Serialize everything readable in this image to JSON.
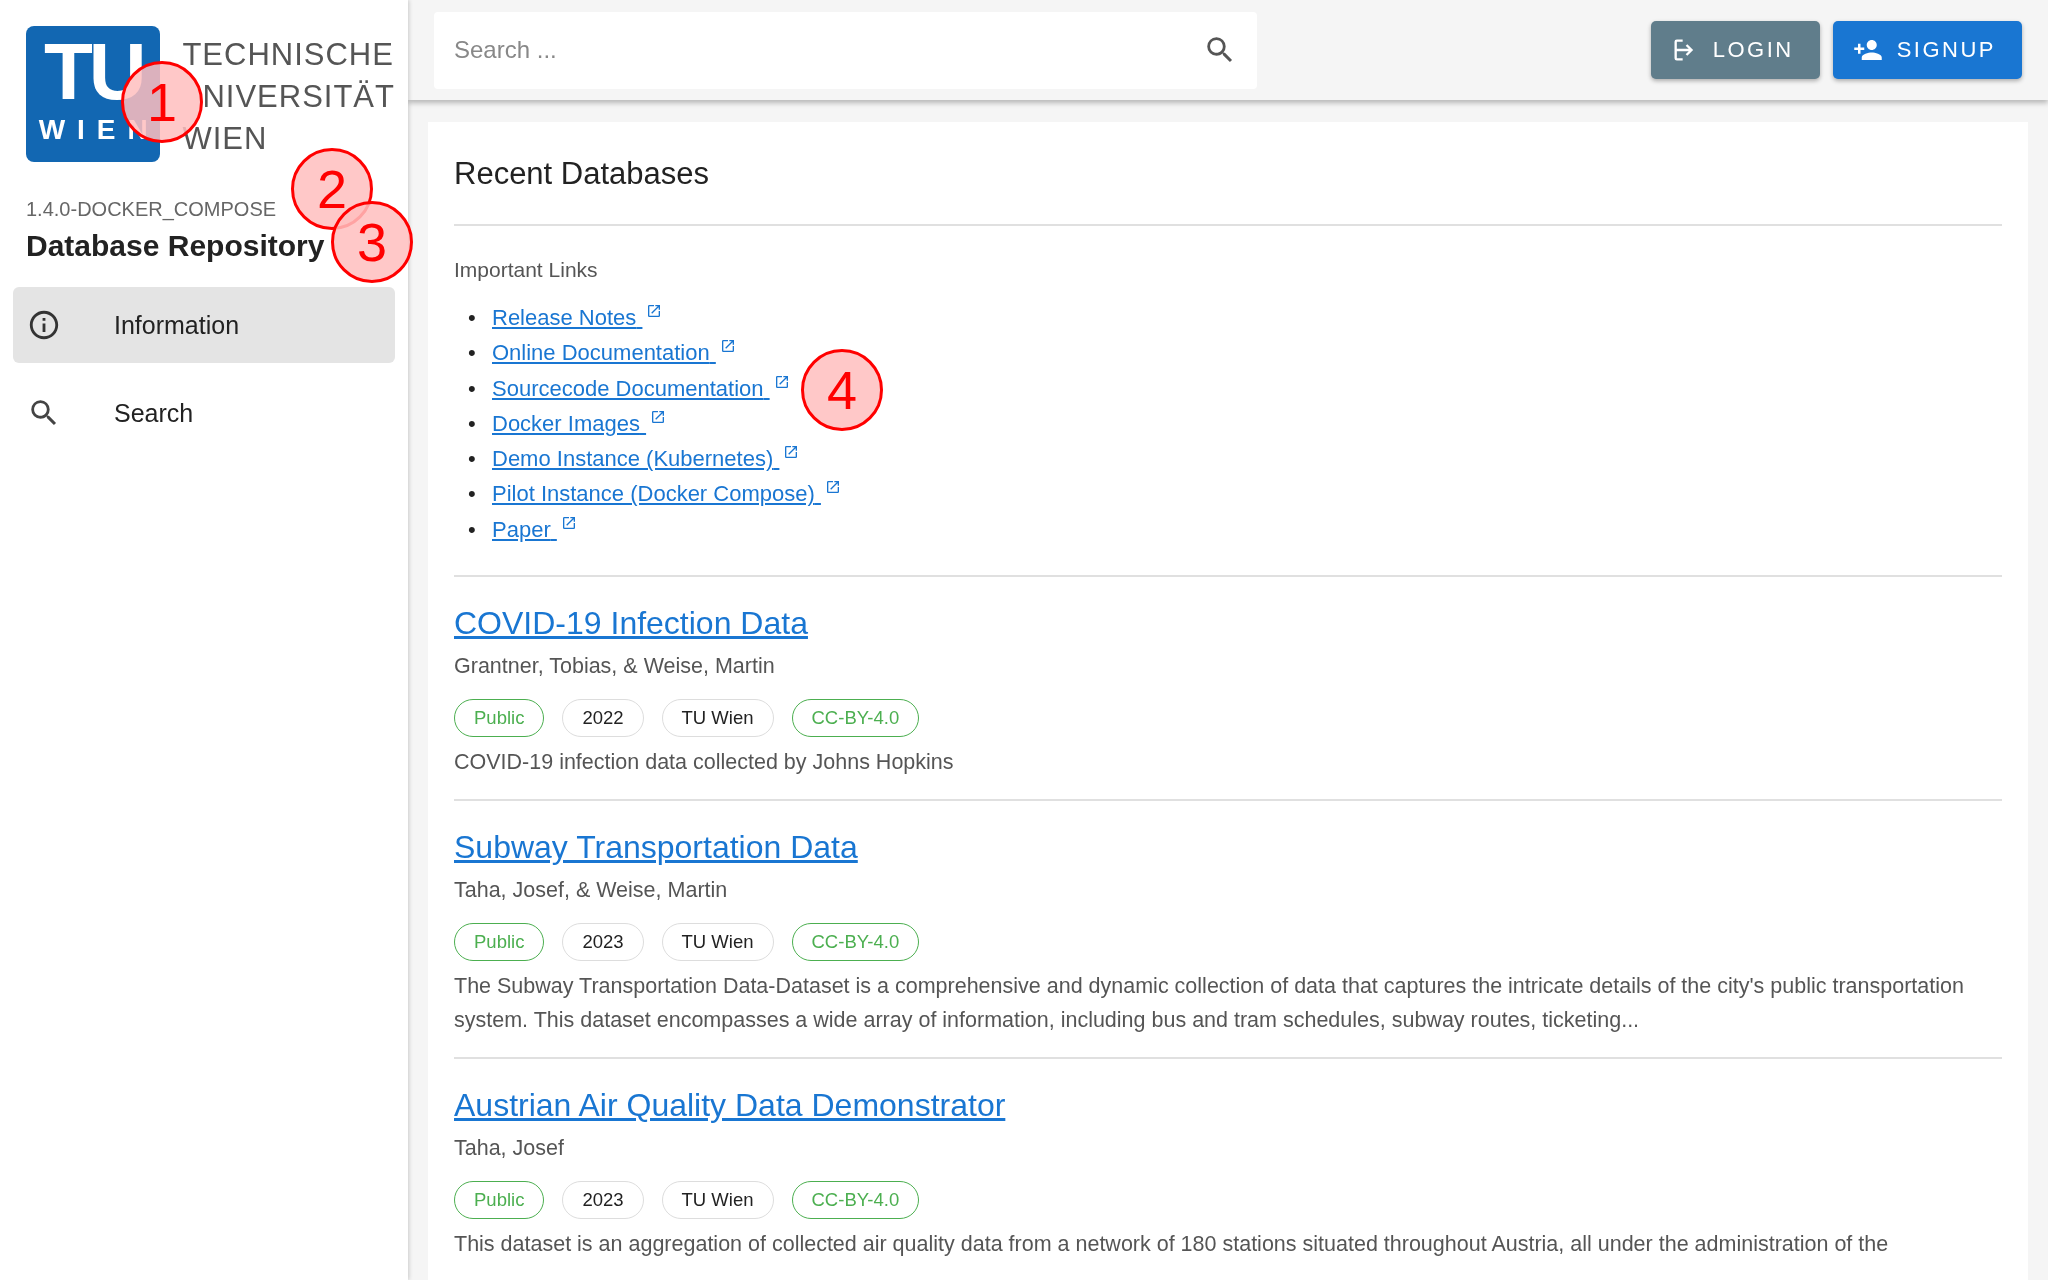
{
  "logo": {
    "mark": "TU",
    "mark_sub": "WIEN",
    "lines": [
      "TECHNISCHE",
      "NIVERSITÄT",
      "WIEN"
    ]
  },
  "version": "1.4.0-DOCKER_COMPOSE",
  "app_title": "Database Repository",
  "sidebar": {
    "items": [
      {
        "label": "Information",
        "selected": true
      },
      {
        "label": "Search",
        "selected": false
      }
    ]
  },
  "search": {
    "placeholder": "Search ..."
  },
  "buttons": [
    {
      "label": "LOGIN",
      "kind": "login"
    },
    {
      "label": "SIGNUP",
      "kind": "signup"
    }
  ],
  "heading": "Recent Databases",
  "links_title": "Important Links",
  "links": [
    {
      "marker": "•",
      "label": "Release Notes"
    },
    {
      "marker": "•",
      "label": "Online Documentation"
    },
    {
      "marker": "•",
      "label": "Sourcecode Documentation"
    },
    {
      "marker": "•",
      "label": "Docker Images"
    },
    {
      "marker": "•",
      "label": "Demo Instance (Kubernetes)"
    },
    {
      "marker": "•",
      "label": "Pilot Instance (Docker Compose)"
    },
    {
      "marker": "•",
      "label": "Paper"
    }
  ],
  "databases": [
    {
      "title": "COVID-19 Infection Data",
      "authors": "Grantner, Tobias, & Weise, Martin",
      "tags": [
        {
          "label": "Public",
          "kind": "success"
        },
        {
          "label": "2022",
          "kind": "neutral"
        },
        {
          "label": "TU Wien",
          "kind": "neutral"
        },
        {
          "label": "CC-BY-4.0",
          "kind": "success"
        }
      ],
      "description": "COVID-19 infection data collected by Johns Hopkins"
    },
    {
      "title": "Subway Transportation Data",
      "authors": "Taha, Josef, & Weise, Martin",
      "tags": [
        {
          "label": "Public",
          "kind": "success"
        },
        {
          "label": "2023",
          "kind": "neutral"
        },
        {
          "label": "TU Wien",
          "kind": "neutral"
        },
        {
          "label": "CC-BY-4.0",
          "kind": "success"
        }
      ],
      "description": "The Subway Transportation Data-Dataset is a comprehensive and dynamic collection of data that captures the intricate details of the city's public transportation system. This dataset encompasses a wide array of information, including bus and tram schedules, subway routes, ticketing..."
    },
    {
      "title": "Austrian Air Quality Data Demonstrator",
      "authors": "Taha, Josef",
      "tags": [
        {
          "label": "Public",
          "kind": "success"
        },
        {
          "label": "2023",
          "kind": "neutral"
        },
        {
          "label": "TU Wien",
          "kind": "neutral"
        },
        {
          "label": "CC-BY-4.0",
          "kind": "success"
        }
      ],
      "description": "This dataset is an aggregation of collected air quality data from a network of 180 stations situated throughout Austria, all under the administration of the"
    }
  ],
  "annotations": [
    {
      "label": "1"
    },
    {
      "label": "2"
    },
    {
      "label": "3"
    },
    {
      "label": "4"
    }
  ]
}
